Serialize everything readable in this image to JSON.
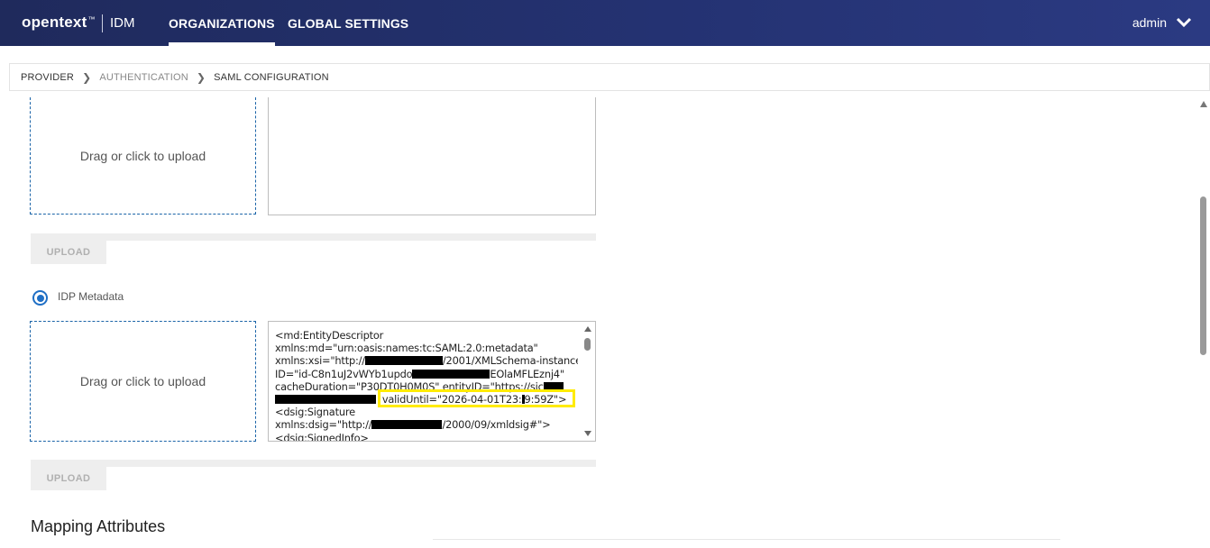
{
  "header": {
    "brand": "opentext",
    "brand_mark": "™",
    "product": "IDM",
    "tabs": [
      {
        "label": "ORGANIZATIONS",
        "active": true
      },
      {
        "label": "GLOBAL SETTINGS",
        "active": false
      }
    ],
    "user": "admin"
  },
  "breadcrumb": [
    {
      "label": "PROVIDER"
    },
    {
      "label": "AUTHENTICATION"
    },
    {
      "label": "SAML CONFIGURATION"
    }
  ],
  "upload_section_1": {
    "dropzone_label": "Drag or click to upload",
    "button_label": "UPLOAD"
  },
  "idp_metadata": {
    "radio_label": "IDP Metadata",
    "selected": true,
    "dropzone_label": "Drag or click to upload",
    "button_label": "UPLOAD",
    "xml_lines": [
      "<md:EntityDescriptor",
      "xmlns:md=\"urn:oasis:names:tc:SAML:2.0:metadata\"",
      "xmlns:xsi=\"http://",
      "/2001/XMLSchema-instance\"",
      "ID=\"id-C8n1uJ2vWYb1updo",
      "EOlaMFLEznj4\"",
      "cacheDuration=\"P30DT0H0M0S\" entityID=\"https://sic",
      "validUntil=\"2026-04-01T23:",
      "9:59Z\">",
      "<dsig:Signature",
      "xmlns:dsig=\"http://",
      "/2000/09/xmldsig#\">",
      "<dsig:SignedInfo>"
    ]
  },
  "mapping": {
    "title": "Mapping Attributes"
  },
  "colors": {
    "header_bg": "#243272",
    "accent": "#1f6fc5",
    "highlight": "#ffeb00"
  }
}
